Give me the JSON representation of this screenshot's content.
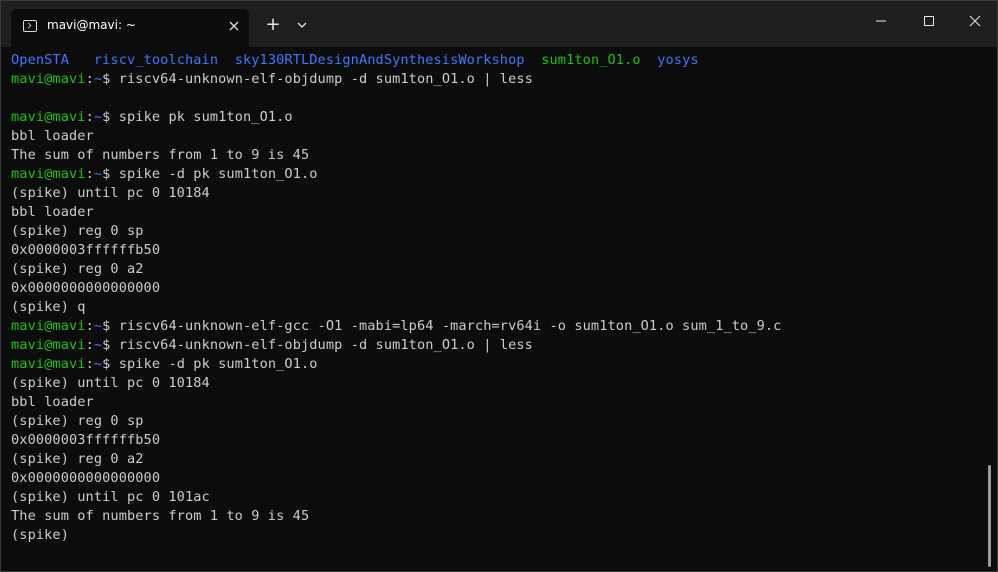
{
  "window": {
    "tab_title": "mavi@mavi: ~",
    "new_tab_label": "+"
  },
  "terminal": {
    "ls_entries": [
      {
        "name": "OpenSTA",
        "color": "#3b78ff"
      },
      {
        "name": "riscv_toolchain",
        "color": "#3b78ff"
      },
      {
        "name": "sky130RTLDesignAndSynthesisWorkshop",
        "color": "#3b78ff"
      },
      {
        "name": "sum1ton_O1.o",
        "color": "#16c60c"
      },
      {
        "name": "yosys",
        "color": "#3b78ff"
      }
    ],
    "prompt": {
      "user": "mavi@mavi",
      "colon": ":",
      "path": "~",
      "dollar": "$"
    },
    "lines": [
      {
        "type": "cmd",
        "text": " riscv64-unknown-elf-objdump -d sum1ton_O1.o | less"
      },
      {
        "type": "blank",
        "text": ""
      },
      {
        "type": "cmd",
        "text": " spike pk sum1ton_O1.o"
      },
      {
        "type": "out",
        "text": "bbl loader"
      },
      {
        "type": "out",
        "text": "The sum of numbers from 1 to 9 is 45"
      },
      {
        "type": "cmd",
        "text": " spike -d pk sum1ton_O1.o"
      },
      {
        "type": "out",
        "text": "(spike) until pc 0 10184"
      },
      {
        "type": "out",
        "text": "bbl loader"
      },
      {
        "type": "out",
        "text": "(spike) reg 0 sp"
      },
      {
        "type": "out",
        "text": "0x0000003ffffffb50"
      },
      {
        "type": "out",
        "text": "(spike) reg 0 a2"
      },
      {
        "type": "out",
        "text": "0x0000000000000000"
      },
      {
        "type": "out",
        "text": "(spike) q"
      },
      {
        "type": "cmd",
        "text": " riscv64-unknown-elf-gcc -O1 -mabi=lp64 -march=rv64i -o sum1ton_O1.o sum_1_to_9.c"
      },
      {
        "type": "cmd",
        "text": " riscv64-unknown-elf-objdump -d sum1ton_O1.o | less"
      },
      {
        "type": "cmd",
        "text": " spike -d pk sum1ton_O1.o"
      },
      {
        "type": "out",
        "text": "(spike) until pc 0 10184"
      },
      {
        "type": "out",
        "text": "bbl loader"
      },
      {
        "type": "out",
        "text": "(spike) reg 0 sp"
      },
      {
        "type": "out",
        "text": "0x0000003ffffffb50"
      },
      {
        "type": "out",
        "text": "(spike) reg 0 a2"
      },
      {
        "type": "out",
        "text": "0x0000000000000000"
      },
      {
        "type": "out",
        "text": "(spike) until pc 0 101ac"
      },
      {
        "type": "out",
        "text": "The sum of numbers from 1 to 9 is 45"
      },
      {
        "type": "out",
        "text": "(spike)"
      }
    ]
  },
  "icons": {
    "tab": "terminal-icon",
    "close_tab": "close-icon",
    "dropdown": "chevron-down-icon",
    "minimize": "minimize-icon",
    "maximize": "maximize-icon",
    "close_window": "close-icon"
  }
}
